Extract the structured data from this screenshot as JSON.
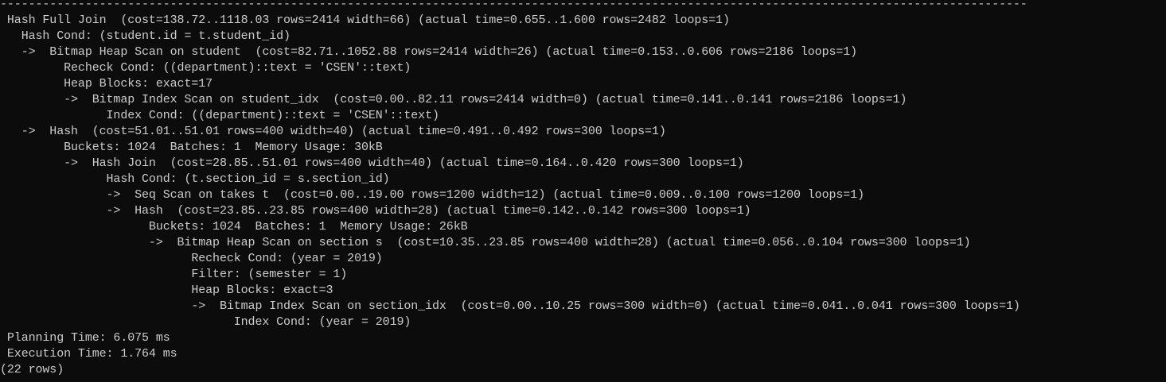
{
  "terminal": {
    "separator": "-------------------------------------------------------------------------------------------------------------------------------------------------",
    "plan_lines": [
      " Hash Full Join  (cost=138.72..1118.03 rows=2414 width=66) (actual time=0.655..1.600 rows=2482 loops=1)",
      "   Hash Cond: (student.id = t.student_id)",
      "   ->  Bitmap Heap Scan on student  (cost=82.71..1052.88 rows=2414 width=26) (actual time=0.153..0.606 rows=2186 loops=1)",
      "         Recheck Cond: ((department)::text = 'CSEN'::text)",
      "         Heap Blocks: exact=17",
      "         ->  Bitmap Index Scan on student_idx  (cost=0.00..82.11 rows=2414 width=0) (actual time=0.141..0.141 rows=2186 loops=1)",
      "               Index Cond: ((department)::text = 'CSEN'::text)",
      "   ->  Hash  (cost=51.01..51.01 rows=400 width=40) (actual time=0.491..0.492 rows=300 loops=1)",
      "         Buckets: 1024  Batches: 1  Memory Usage: 30kB",
      "         ->  Hash Join  (cost=28.85..51.01 rows=400 width=40) (actual time=0.164..0.420 rows=300 loops=1)",
      "               Hash Cond: (t.section_id = s.section_id)",
      "               ->  Seq Scan on takes t  (cost=0.00..19.00 rows=1200 width=12) (actual time=0.009..0.100 rows=1200 loops=1)",
      "               ->  Hash  (cost=23.85..23.85 rows=400 width=28) (actual time=0.142..0.142 rows=300 loops=1)",
      "                     Buckets: 1024  Batches: 1  Memory Usage: 26kB",
      "                     ->  Bitmap Heap Scan on section s  (cost=10.35..23.85 rows=400 width=28) (actual time=0.056..0.104 rows=300 loops=1)",
      "                           Recheck Cond: (year = 2019)",
      "                           Filter: (semester = 1)",
      "                           Heap Blocks: exact=3",
      "                           ->  Bitmap Index Scan on section_idx  (cost=0.00..10.25 rows=300 width=0) (actual time=0.041..0.041 rows=300 loops=1)",
      "                                 Index Cond: (year = 2019)",
      " Planning Time: 6.075 ms",
      " Execution Time: 1.764 ms"
    ],
    "row_count": "(22 rows)"
  }
}
